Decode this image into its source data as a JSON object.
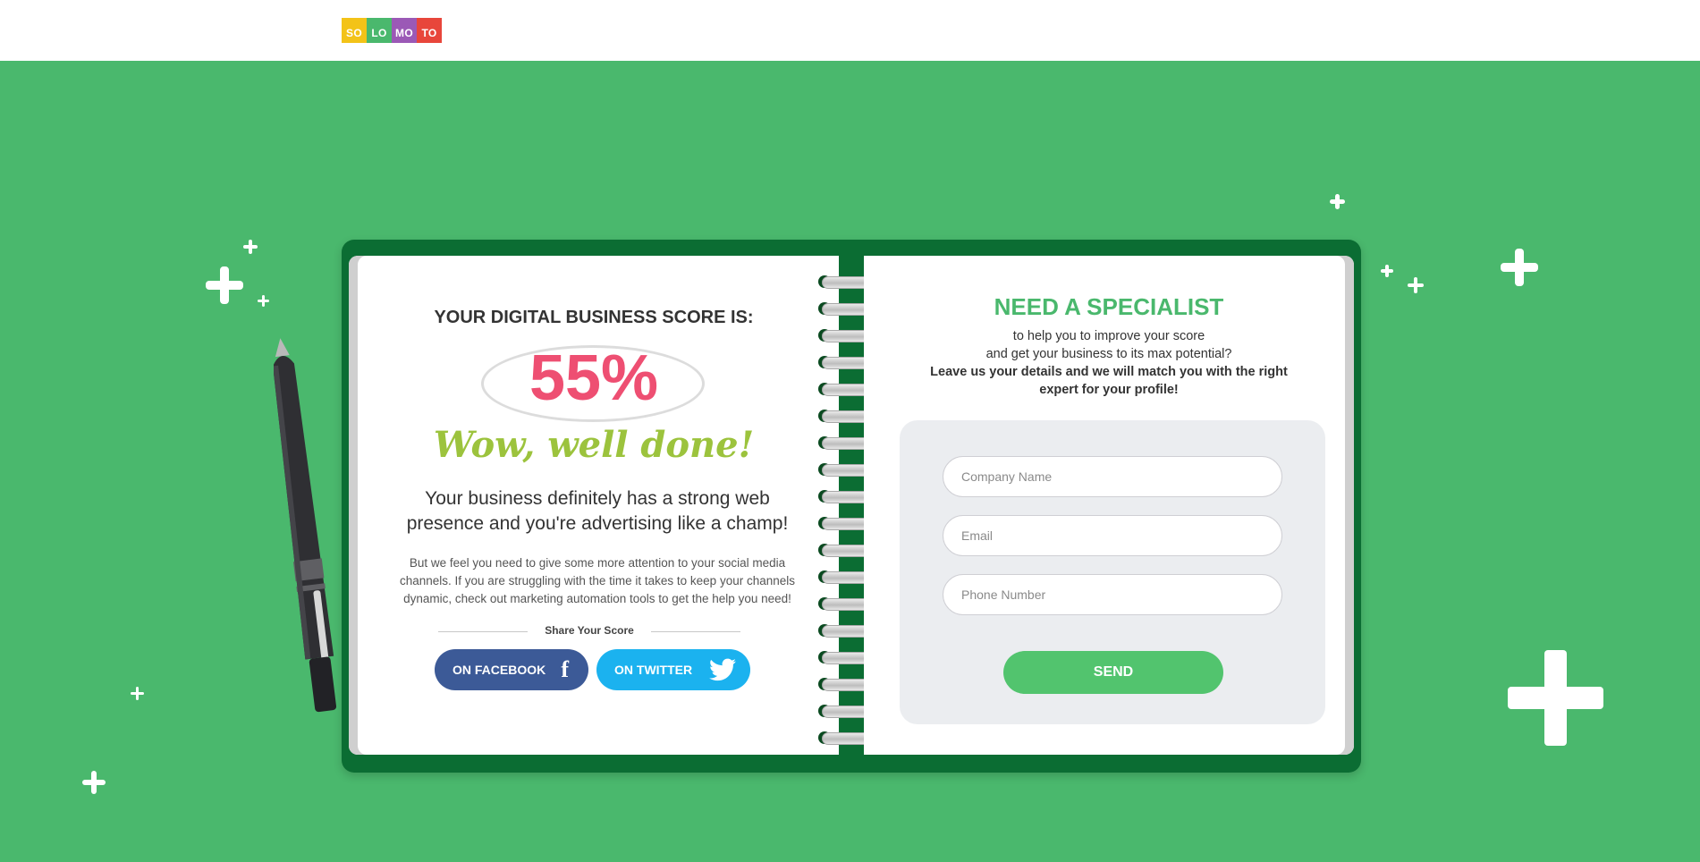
{
  "logo": {
    "letters": [
      "SO",
      "LO",
      "MO",
      "TO"
    ],
    "colors": [
      "#f3c318",
      "#4ab86d",
      "#9b59b6",
      "#e8463b"
    ]
  },
  "colors": {
    "background": "#4ab86d",
    "accent_green": "#4ab86d",
    "score_pink": "#ee4f72",
    "wow_green": "#9cc33d",
    "facebook": "#3c5a97",
    "twitter": "#1bb2ef",
    "send": "#52c46e",
    "notebook": "#0b6d33"
  },
  "score": {
    "title": "YOUR DIGITAL BUSINESS SCORE IS:",
    "value": "55%",
    "wow": "Wow, well done!",
    "strong_line1": "Your business definitely has a strong web",
    "strong_line2": "presence and you're advertising like a champ!",
    "advice_line1": "But we feel you need to give some more attention to your social media",
    "advice_line2": "channels. If you are struggling with the time it takes to keep your channels",
    "advice_line3": "dynamic, check out marketing automation tools to get the help you need!",
    "share_label": "Share Your Score",
    "facebook_label": "ON FACEBOOK",
    "twitter_label": "ON TWITTER",
    "facebook_icon": "facebook-icon",
    "twitter_icon": "twitter-icon"
  },
  "specialist": {
    "title": "NEED A SPECIALIST",
    "line1": "to help you to improve your score",
    "line2": "and get your business to its max potential?",
    "line3": "Leave us your details and we will match you with the right",
    "line4": "expert for your profile!",
    "company_placeholder": "Company Name",
    "email_placeholder": "Email",
    "phone_placeholder": "Phone Number",
    "send_label": "SEND"
  }
}
